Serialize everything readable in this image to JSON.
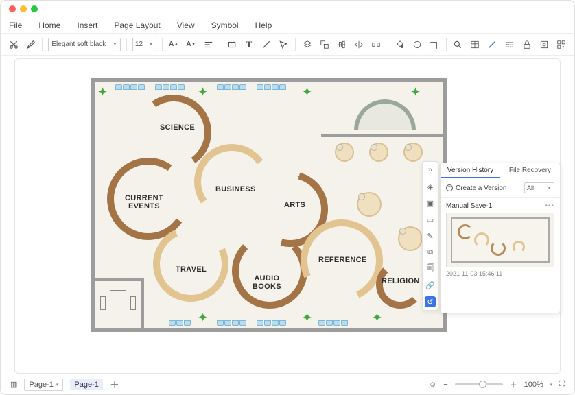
{
  "menu": {
    "file": "File",
    "home": "Home",
    "insert": "Insert",
    "page_layout": "Page Layout",
    "view": "View",
    "symbol": "Symbol",
    "help": "Help"
  },
  "toolbar": {
    "font": "Elegant soft black",
    "size": "12"
  },
  "floorplan": {
    "zones": {
      "science": "SCIENCE",
      "current_events": "CURRENT\nEVENTS",
      "business": "BUSINESS",
      "arts": "ARTS",
      "travel": "TRAVEL",
      "audio_books": "AUDIO\nBOOKS",
      "reference": "REFERENCE",
      "religion": "RELIGION"
    }
  },
  "panel": {
    "tab_history": "Version History",
    "tab_recovery": "File Recovery",
    "create": "Create a Version",
    "filter": "All",
    "version_name": "Manual Save-1",
    "version_time": "2021-11-03 15:46:11"
  },
  "status": {
    "page_sel": "Page-1",
    "page_tab": "Page-1",
    "zoom": "100%"
  }
}
